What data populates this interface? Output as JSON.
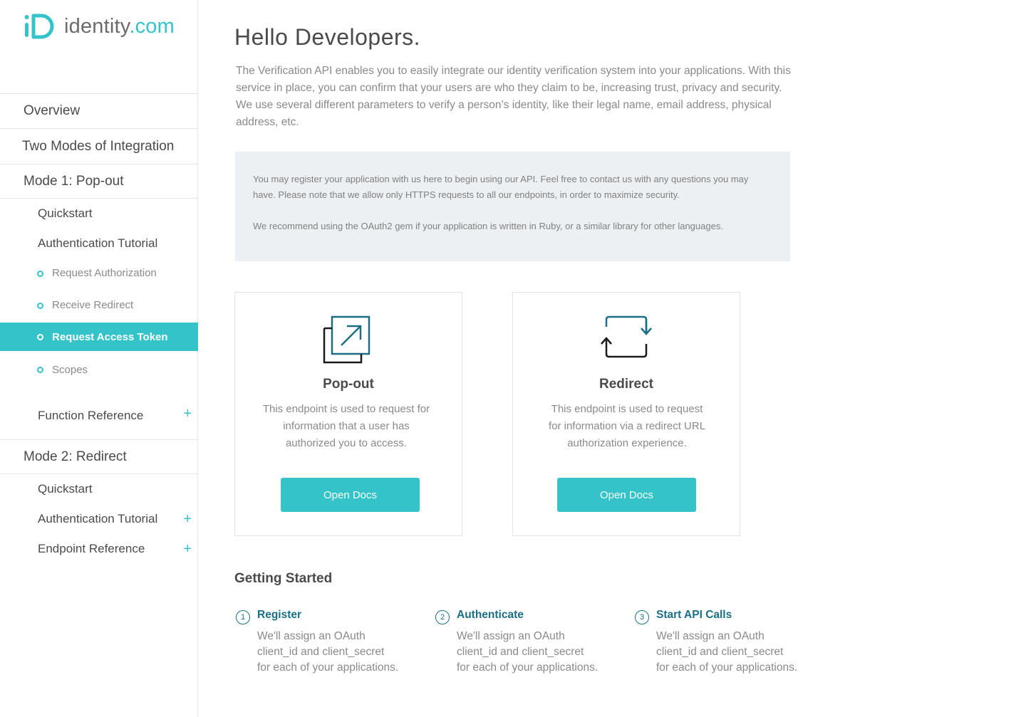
{
  "brand": {
    "logo_name": "identity",
    "logo_tld": ".com",
    "accent_color": "#33c3c9",
    "dark_accent_color": "#1a6f86"
  },
  "sidebar": {
    "overview": "Overview",
    "two_modes": "Two Modes of Integration",
    "mode1": {
      "label": "Mode 1: Pop-out",
      "quickstart": "Quickstart",
      "auth_tutorial": "Authentication Tutorial",
      "subitems": [
        "Request Authorization",
        "Receive Redirect",
        "Request Access Token",
        "Scopes"
      ],
      "active_subitem": "Request Access Token",
      "function_reference": "Function Reference"
    },
    "mode2": {
      "label": "Mode 2: Redirect",
      "quickstart": "Quickstart",
      "auth_tutorial": "Authentication Tutorial",
      "endpoint_reference": "Endpoint Reference"
    },
    "expand_glyph": "+"
  },
  "main": {
    "title": "Hello Developers.",
    "intro": "The Verification API enables you to easily integrate our identity verification system into your applications. With this service in place, you can confirm that your users are who they claim to be, increasing trust, privacy and security. We use several different parameters to verify a person’s identity, like their legal name, email address, physical address, etc.",
    "notice_p1": "You may register your application with us here to begin using our API. Feel free to contact us with any questions you may have. Please note that we allow only HTTPS requests to all our endpoints, in order to maximize security.",
    "notice_p2": "We recommend using the OAuth2 gem if your application is written in Ruby, or a similar library for other languages.",
    "cards": [
      {
        "icon": "popout-icon",
        "title": "Pop-out",
        "desc_lines": [
          "This endpoint is used to request for",
          "information that a user has",
          "authorized you to access."
        ],
        "button": "Open Docs"
      },
      {
        "icon": "redirect-icon",
        "title": "Redirect",
        "desc_lines": [
          "This endpoint is used to request",
          "for information via a redirect URL",
          "authorization experience."
        ],
        "button": "Open Docs"
      }
    ],
    "getting_started": {
      "title": "Getting Started",
      "steps": [
        {
          "num": "1",
          "title": "Register",
          "desc_lines": [
            "We'll assign an OAuth",
            "client_id and client_secret",
            "for each of your applications."
          ]
        },
        {
          "num": "2",
          "title": "Authenticate",
          "desc_lines": [
            "We'll assign an OAuth",
            "client_id and client_secret",
            "for each of your applications."
          ]
        },
        {
          "num": "3",
          "title": "Start API Calls",
          "desc_lines": [
            "We'll assign an OAuth",
            "client_id and client_secret",
            "for each of your applications."
          ]
        }
      ]
    }
  }
}
